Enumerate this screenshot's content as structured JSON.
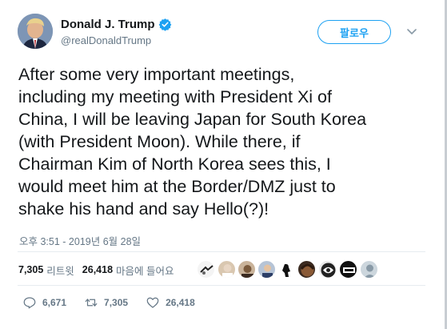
{
  "header": {
    "display_name": "Donald J. Trump",
    "handle": "@realDonaldTrump",
    "follow_label": "팔로우"
  },
  "tweet": {
    "lines": [
      "After some very important meetings,",
      "including my meeting with President Xi of",
      "China, I will be leaving Japan for South Korea",
      "(with President Moon). While there, if",
      "Chairman Kim of North Korea sees this, I",
      "would meet him at the Border/DMZ just to",
      "shake his hand and say Hello(?)!"
    ],
    "timestamp": "오후 3:51 - 2019년 6월 28일"
  },
  "stats": {
    "retweets_count": "7,305",
    "retweets_label": "리트윗",
    "likes_count": "26,418",
    "likes_label": "마음에 들어요"
  },
  "actions": {
    "replies": "6,671",
    "retweets": "7,305",
    "likes": "26,418"
  },
  "colors": {
    "accent": "#1da1f2",
    "muted": "#657786",
    "divider": "#e6ecf0"
  }
}
